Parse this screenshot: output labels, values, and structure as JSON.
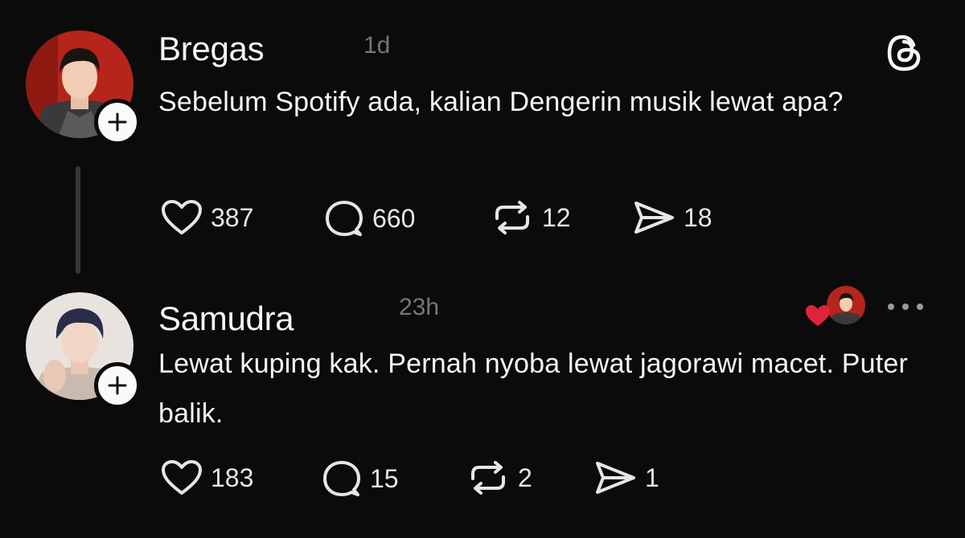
{
  "app": {
    "name": "Threads",
    "logo_icon": "threads-logo-icon"
  },
  "colors": {
    "background": "#0b0b0b",
    "text": "#f3f5f7",
    "muted": "#777777",
    "like_red": "#e0233a"
  },
  "posts": [
    {
      "username": "Bregas",
      "time": "1d",
      "text": "Sebelum Spotify ada, kalian Dengerin musik lewat apa?",
      "actions": {
        "likes": "387",
        "replies": "660",
        "reposts": "12",
        "shares": "18"
      }
    },
    {
      "username": "Samudra",
      "time": "23h",
      "text": "Lewat kuping kak. Pernah nyoba lewat jagorawi macet. Puter balik.",
      "liked_by_author": true,
      "actions": {
        "likes": "183",
        "replies": "15",
        "reposts": "2",
        "shares": "1"
      }
    }
  ],
  "icons": {
    "like": "heart-icon",
    "reply": "comment-icon",
    "repost": "repost-icon",
    "share": "send-icon",
    "follow": "plus-icon",
    "menu": "more-horizontal-icon"
  }
}
